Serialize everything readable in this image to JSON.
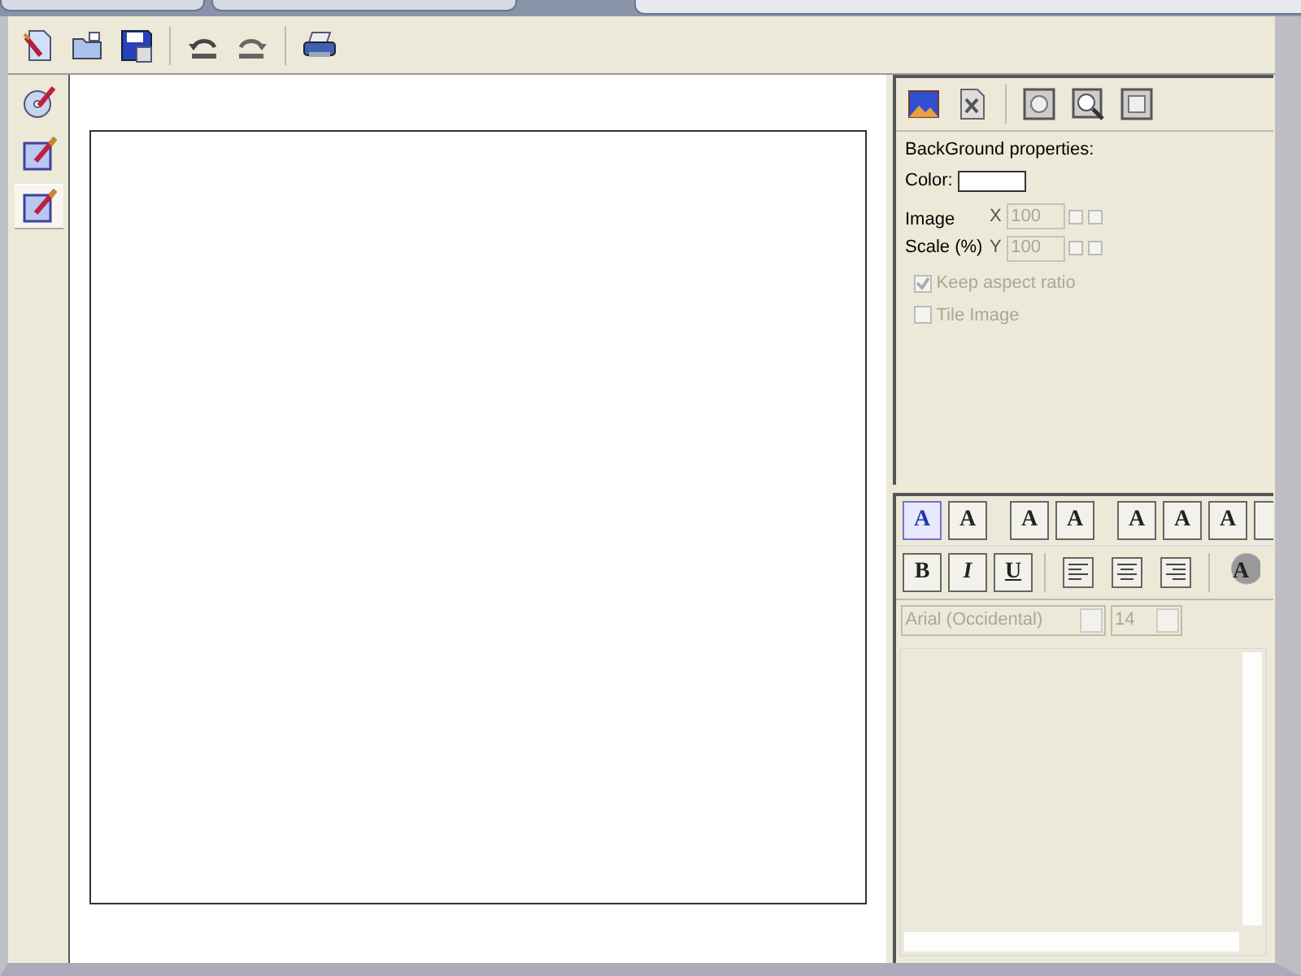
{
  "window_tabs": [
    {
      "selected": false
    },
    {
      "selected": false
    },
    {
      "selected": true
    }
  ],
  "toolbar": [
    {
      "kind": "new"
    },
    {
      "kind": "open"
    },
    {
      "kind": "save"
    },
    {
      "kind": "sep"
    },
    {
      "kind": "undo"
    },
    {
      "kind": "redo"
    },
    {
      "kind": "sep"
    },
    {
      "kind": "print"
    }
  ],
  "side_tabs": [
    {
      "kind": "disc",
      "selected": false
    },
    {
      "kind": "edit",
      "selected": false
    },
    {
      "kind": "edit",
      "selected": true
    }
  ],
  "background_panel": {
    "tools": [
      {
        "kind": "landscape"
      },
      {
        "kind": "delete"
      },
      {
        "kind": "sep"
      },
      {
        "kind": "fit"
      },
      {
        "kind": "zoom"
      },
      {
        "kind": "stretch"
      }
    ],
    "title": "BackGround properties:",
    "color_label": "Color:",
    "color": "#ffffff",
    "image_label": "Image",
    "scale_label": "Scale (%)",
    "scale": [
      {
        "axis": "X",
        "value": "100"
      },
      {
        "axis": "Y",
        "value": "100"
      }
    ],
    "options": [
      {
        "label": "Keep aspect ratio",
        "checked": true,
        "disabled": true
      },
      {
        "label": "Tile Image",
        "checked": false,
        "disabled": true
      }
    ]
  },
  "text_panel": {
    "text_tools": [
      {
        "label": "A",
        "kind": "add"
      },
      {
        "label": "A",
        "kind": "delete-text"
      },
      {
        "kind": "sep"
      },
      {
        "label": "A",
        "kind": "rotate-right"
      },
      {
        "label": "A",
        "kind": "rotate-left"
      },
      {
        "kind": "sep"
      },
      {
        "label": "A",
        "kind": "layer"
      },
      {
        "label": "A",
        "kind": "layer"
      },
      {
        "label": "A",
        "kind": "layer"
      },
      {
        "kind": "layer"
      }
    ],
    "format_tools": [
      {
        "label": "B",
        "kind": "bold"
      },
      {
        "label": "I",
        "kind": "italic"
      },
      {
        "label": "U",
        "kind": "underline"
      },
      {
        "kind": "sep"
      },
      {
        "kind": "align-left"
      },
      {
        "kind": "align-center"
      },
      {
        "kind": "align-right"
      },
      {
        "kind": "sep"
      },
      {
        "label": "A",
        "kind": "palette"
      }
    ],
    "font": "Arial (Occidental)",
    "size": "14"
  }
}
